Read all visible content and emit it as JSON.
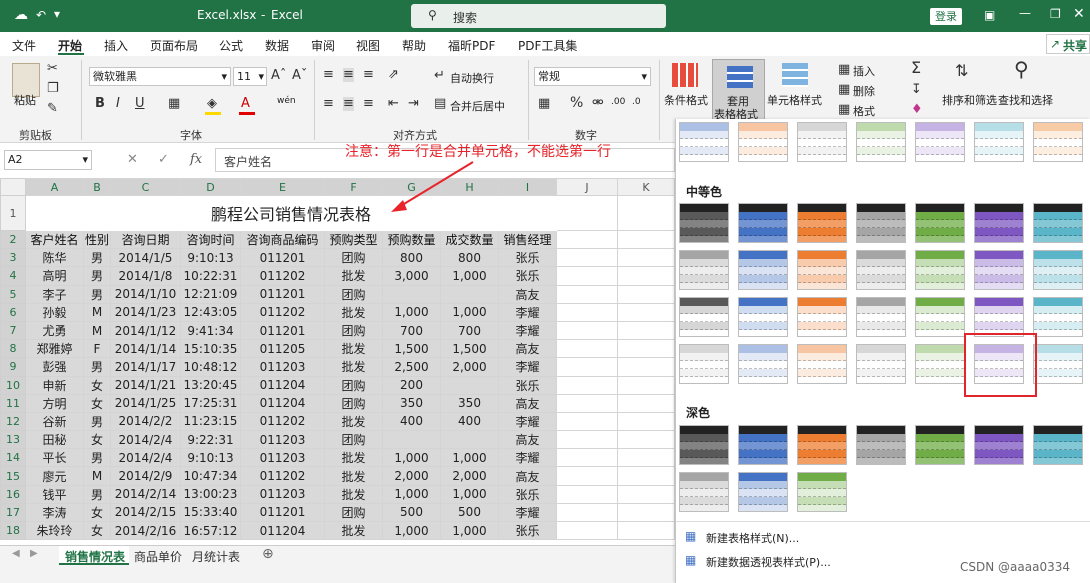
{
  "window": {
    "filename": "Excel.xlsx",
    "app": "Excel",
    "search_placeholder": "搜索",
    "login": "登录"
  },
  "menu": {
    "items": [
      "文件",
      "开始",
      "插入",
      "页面布局",
      "公式",
      "数据",
      "审阅",
      "视图",
      "帮助",
      "福昕PDF",
      "PDF工具集"
    ],
    "share": "共享"
  },
  "ribbon": {
    "paste": "粘贴",
    "font_name": "微软雅黑",
    "font_size": "11",
    "wrap": "自动换行",
    "merge": "合并后居中",
    "number_format": "常规",
    "cond_format": "条件格式",
    "table_format_1": "套用",
    "table_format_2": "表格格式",
    "cell_style": "单元格样式",
    "insert": "插入",
    "delete": "删除",
    "format": "格式",
    "sort": "排序和筛选",
    "find": "查找和选择",
    "groups": [
      "剪贴板",
      "字体",
      "对齐方式",
      "数字"
    ]
  },
  "formula_bar": {
    "name_box": "A2",
    "fx": "fx",
    "content": "客户姓名"
  },
  "annotation": "注意：第一行是合并单元格，不能选第一行",
  "sheet": {
    "columns": [
      "A",
      "B",
      "C",
      "D",
      "E",
      "F",
      "G",
      "H",
      "I",
      "J",
      "K"
    ],
    "title": "鹏程公司销售情况表格",
    "headers": [
      "客户姓名",
      "性别",
      "咨询日期",
      "咨询时间",
      "咨询商品编码",
      "预购类型",
      "预购数量",
      "成交数量",
      "销售经理"
    ],
    "rows": [
      [
        "陈华",
        "男",
        "2014/1/5",
        "9:10:13",
        "011201",
        "团购",
        "800",
        "800",
        "张乐"
      ],
      [
        "高明",
        "男",
        "2014/1/8",
        "10:22:31",
        "011202",
        "批发",
        "3,000",
        "1,000",
        "张乐"
      ],
      [
        "李子",
        "男",
        "2014/1/10",
        "12:21:09",
        "011201",
        "团购",
        "",
        "",
        "高友"
      ],
      [
        "孙毅",
        "M",
        "2014/1/23",
        "12:43:05",
        "011202",
        "批发",
        "1,000",
        "1,000",
        "李耀"
      ],
      [
        "尤勇",
        "M",
        "2014/1/12",
        "9:41:34",
        "011201",
        "团购",
        "700",
        "700",
        "李耀"
      ],
      [
        "郑雅婷",
        "F",
        "2014/1/14",
        "15:10:35",
        "011205",
        "批发",
        "1,500",
        "1,500",
        "高友"
      ],
      [
        "彭强",
        "男",
        "2014/1/17",
        "10:48:12",
        "011203",
        "批发",
        "2,500",
        "2,000",
        "李耀"
      ],
      [
        "申新",
        "女",
        "2014/1/21",
        "13:20:45",
        "011204",
        "团购",
        "200",
        "",
        "张乐"
      ],
      [
        "方明",
        "女",
        "2014/1/25",
        "17:25:31",
        "011204",
        "团购",
        "350",
        "350",
        "高友"
      ],
      [
        "谷新",
        "男",
        "2014/2/2",
        "11:23:15",
        "011202",
        "批发",
        "400",
        "400",
        "李耀"
      ],
      [
        "田秘",
        "女",
        "2014/2/4",
        "9:22:31",
        "011203",
        "团购",
        "",
        "",
        "高友"
      ],
      [
        "平长",
        "男",
        "2014/2/4",
        "9:10:13",
        "011203",
        "批发",
        "1,000",
        "1,000",
        "李耀"
      ],
      [
        "廖元",
        "M",
        "2014/2/9",
        "10:47:34",
        "011202",
        "批发",
        "2,000",
        "2,000",
        "高友"
      ],
      [
        "钱平",
        "男",
        "2014/2/14",
        "13:00:23",
        "011203",
        "批发",
        "1,000",
        "1,000",
        "张乐"
      ],
      [
        "李涛",
        "女",
        "2014/2/15",
        "15:33:40",
        "011201",
        "团购",
        "500",
        "500",
        "李耀"
      ],
      [
        "朱玲玲",
        "女",
        "2014/2/16",
        "16:57:12",
        "011204",
        "批发",
        "1,000",
        "1,000",
        "张乐"
      ]
    ]
  },
  "tabs": [
    "销售情况表",
    "商品单价",
    "月统计表"
  ],
  "gallery": {
    "medium": "中等色",
    "dark": "深色",
    "new_table_style": "新建表格样式(N)...",
    "new_pivot_style": "新建数据透视表样式(P)...",
    "palette": [
      "#595959",
      "#4472c4",
      "#ed7d31",
      "#a5a5a5",
      "#70ad47",
      "#7e57c2",
      "#5bb5c8",
      "#f08c3c"
    ]
  },
  "watermark": "CSDN @aaaa0334"
}
